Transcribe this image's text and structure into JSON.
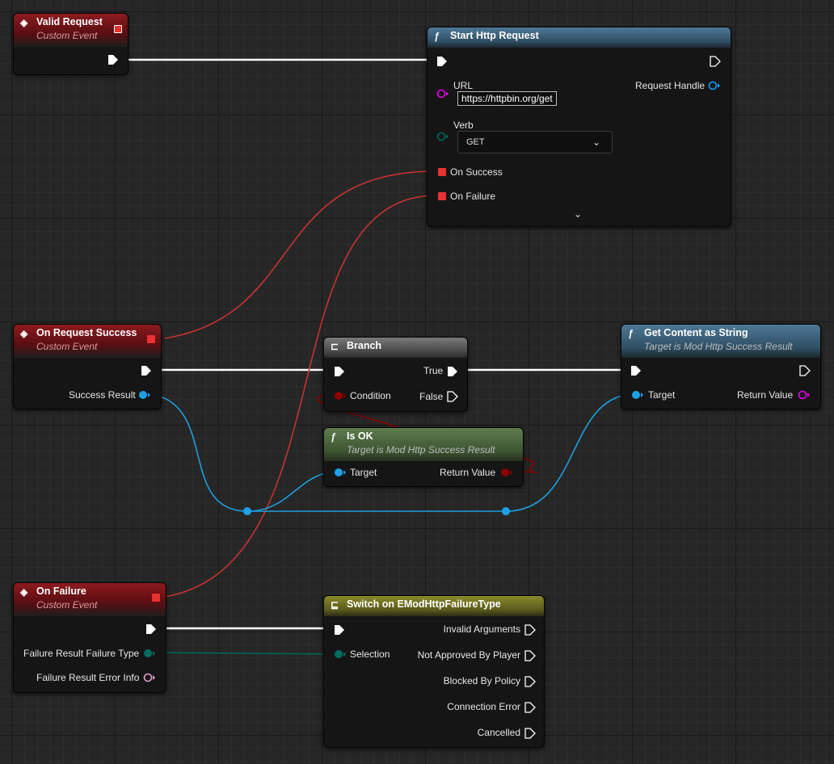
{
  "nodes": {
    "valid_request": {
      "title": "Valid Request",
      "subtitle": "Custom Event"
    },
    "start_http": {
      "title": "Start Http Request",
      "url_label": "URL",
      "url_value": "https://httpbin.org/get",
      "request_handle_label": "Request Handle",
      "verb_label": "Verb",
      "verb_value": "GET",
      "on_success_label": "On Success",
      "on_failure_label": "On Failure"
    },
    "on_request_success": {
      "title": "On Request Success",
      "subtitle": "Custom Event",
      "success_result_label": "Success Result"
    },
    "branch": {
      "title": "Branch",
      "true_label": "True",
      "false_label": "False",
      "condition_label": "Condition"
    },
    "get_content": {
      "title": "Get Content as String",
      "subtitle": "Target is Mod Http Success Result",
      "target_label": "Target",
      "return_label": "Return Value"
    },
    "is_ok": {
      "title": "Is OK",
      "subtitle": "Target is Mod Http Success Result",
      "target_label": "Target",
      "return_label": "Return Value"
    },
    "on_failure": {
      "title": "On Failure",
      "subtitle": "Custom Event",
      "failure_type_label": "Failure Result Failure Type",
      "error_info_label": "Failure Result Error Info"
    },
    "switch": {
      "title": "Switch on EModHttpFailureType",
      "selection_label": "Selection",
      "outputs": [
        "Invalid Arguments",
        "Not Approved By Player",
        "Blocked By Policy",
        "Connection Error",
        "Cancelled"
      ]
    }
  },
  "colors": {
    "exec": "#ffffff",
    "delegate": "#e83232",
    "struct": "#1ea0e6",
    "bool": "#8c0000",
    "string": "#e600e6",
    "enum": "#006c60",
    "error_info": "#e6a0c8",
    "handle": "#0aa0ff"
  },
  "icons": {
    "event": "event-diamond-icon",
    "function": "function-f-icon",
    "branch": "branch-icon",
    "switch": "switch-icon",
    "advanced": "chevron-down-icon"
  }
}
